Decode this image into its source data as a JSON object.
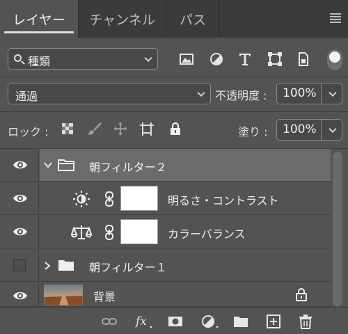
{
  "tabs": [
    {
      "label": "レイヤー",
      "active": true
    },
    {
      "label": "チャンネル",
      "active": false
    },
    {
      "label": "パス",
      "active": false
    }
  ],
  "filter": {
    "label": "種類"
  },
  "blend": {
    "mode": "通過",
    "opacity_label": "不透明度 :",
    "opacity_value": "100%"
  },
  "lock": {
    "label": "ロック :",
    "fill_label": "塗り :",
    "fill_value": "100%"
  },
  "layers": [
    {
      "name": "朝フィルター２",
      "type": "group",
      "expanded": true,
      "visible": true,
      "selected": true
    },
    {
      "name": "明るさ・コントラスト",
      "type": "adjustment",
      "icon": "brightness-contrast-icon",
      "visible": true
    },
    {
      "name": "カラーバランス",
      "type": "adjustment",
      "icon": "color-balance-icon",
      "visible": true
    },
    {
      "name": "朝フィルター１",
      "type": "group",
      "expanded": false,
      "visible": false
    },
    {
      "name": "背景",
      "type": "background",
      "visible": true,
      "locked": true
    }
  ],
  "colors": {
    "panel": "#535353",
    "tabbar": "#3b3b3b",
    "selected": "#6b6b6b"
  }
}
